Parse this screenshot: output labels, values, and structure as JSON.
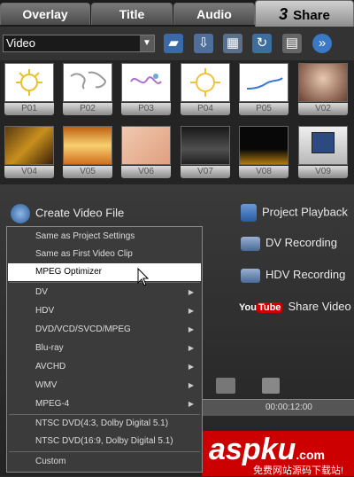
{
  "tabs": [
    {
      "label": "Overlay"
    },
    {
      "label": "Title"
    },
    {
      "label": "Audio"
    },
    {
      "num": "3",
      "label": "Share",
      "active": true
    }
  ],
  "toolbar": {
    "selected": "Video"
  },
  "thumbnails": [
    "P01",
    "P02",
    "P03",
    "P04",
    "P05",
    "V02",
    "V04",
    "V05",
    "V06",
    "V07",
    "V08",
    "V09"
  ],
  "panel": {
    "create_video": "Create Video File",
    "project_playback": "Project Playback",
    "dv_recording": "DV Recording",
    "hdv_recording": "HDV Recording",
    "youtube_logo": "YouTube",
    "share_video": "Share Video O"
  },
  "timeline": {
    "time": "00:00:12:00"
  },
  "menu": {
    "items": [
      {
        "label": "Same as Project Settings"
      },
      {
        "label": "Same as First Video Clip"
      },
      {
        "label": "MPEG Optimizer",
        "selected": true
      },
      {
        "label": "DV",
        "submenu": true
      },
      {
        "label": "HDV",
        "submenu": true
      },
      {
        "label": "DVD/VCD/SVCD/MPEG",
        "submenu": true
      },
      {
        "label": "Blu-ray",
        "submenu": true
      },
      {
        "label": "AVCHD",
        "submenu": true
      },
      {
        "label": "WMV",
        "submenu": true
      },
      {
        "label": "MPEG-4",
        "submenu": true
      },
      {
        "label": "NTSC  DVD(4:3, Dolby Digital 5.1)"
      },
      {
        "label": "NTSC  DVD(16:9, Dolby Digital 5.1)"
      },
      {
        "label": "Custom"
      }
    ]
  },
  "watermark": {
    "brand": "aspku",
    "tld": ".com",
    "tagline": "免费网站源码下载站!"
  },
  "colors": {
    "accent_red": "#cc0000",
    "menu_bg": "#3b3b3b",
    "selected_bg": "#ffffff"
  }
}
